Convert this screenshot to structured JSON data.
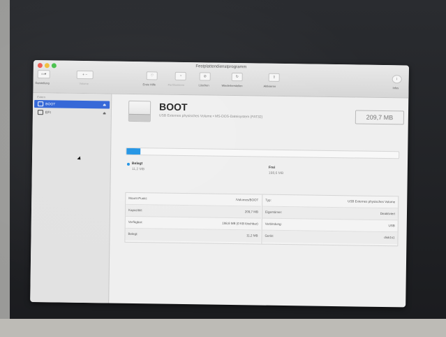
{
  "window": {
    "title": "Festplattendienstprogramm"
  },
  "toolbar": {
    "view_label": "Darstellung",
    "volume_label": "Volume",
    "items": [
      {
        "label": "Erste Hilfe",
        "icon": "stethoscope-icon",
        "enabled": true
      },
      {
        "label": "Partitionieren",
        "icon": "partition-icon",
        "enabled": false
      },
      {
        "label": "Löschen",
        "icon": "erase-icon",
        "enabled": true
      },
      {
        "label": "Wiederherstellen",
        "icon": "restore-icon",
        "enabled": true
      },
      {
        "label": "Aktivieren",
        "icon": "mount-icon",
        "enabled": true
      }
    ],
    "info_label": "Infos"
  },
  "sidebar": {
    "header": "Extern",
    "items": [
      {
        "label": "BOOT",
        "selected": true,
        "eject": "⏏"
      },
      {
        "label": "EFI",
        "selected": false,
        "eject": "⏏"
      }
    ]
  },
  "volume": {
    "name": "BOOT",
    "description": "USB Externes physisches Volume • MS-DOS-Dateisystem (FAT32)",
    "capacity": "209,7 MB"
  },
  "usage": {
    "used_fraction": 0.05,
    "used_color": "#1e92e4",
    "used_label": "Belegt",
    "used_value": "11,2 MB",
    "free_label": "Frei",
    "free_value": "198,6 MB"
  },
  "details": {
    "left": [
      {
        "key": "Mount-Punkt:",
        "value": "/Volumes/BOOT"
      },
      {
        "key": "Kapazität:",
        "value": "209,7 MB"
      },
      {
        "key": "Verfügbar:",
        "value": "198,6 MB (0 KB löschbar)"
      },
      {
        "key": "Belegt:",
        "value": "11,2 MB"
      }
    ],
    "right": [
      {
        "key": "Typ:",
        "value": "USB Externes physisches Volume"
      },
      {
        "key": "Eigentümer:",
        "value": "Deaktiviert"
      },
      {
        "key": "Verbindung:",
        "value": "USB"
      },
      {
        "key": "Gerät:",
        "value": "disk1s1"
      }
    ]
  }
}
